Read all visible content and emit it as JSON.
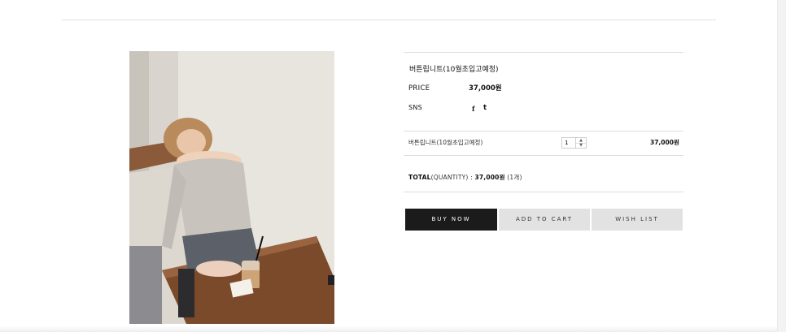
{
  "product": {
    "name": "버튼립니트(10월초입고예정)",
    "price_label": "PRICE",
    "price": "37,000원",
    "sns_label": "SNS",
    "sns_facebook": "f",
    "sns_twitter": "t"
  },
  "option": {
    "name": "버튼립니트(10월초입고예정)",
    "quantity": "1",
    "price": "37,000원"
  },
  "total": {
    "label": "TOTAL",
    "sub": "(QUANTITY) : ",
    "amount": "37,000원",
    "count": " (1개)"
  },
  "buttons": {
    "buy": "BUY NOW",
    "cart": "ADD TO CART",
    "wish": "WISH LIST"
  },
  "colors": {
    "buy_bg": "#1b1b1b",
    "secondary_bg": "#e2e2e2"
  }
}
